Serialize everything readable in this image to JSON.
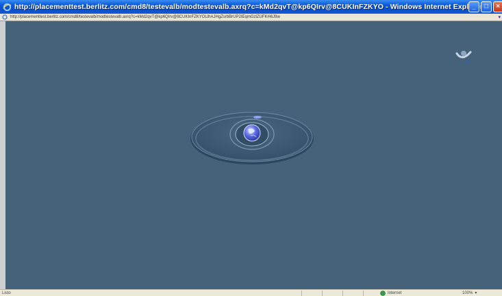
{
  "window": {
    "title": "http://placementtest.berlitz.com/cmd8/testevalb/modtestevalb.axrq?c=kMd2qvT@kp6QIrv@8CUKInFZKYO - Windows Internet Explorer",
    "buttons": {
      "minimize": "_",
      "maximize": "□",
      "close": "×"
    }
  },
  "address": {
    "url": "http://placementtest.berlitz.com/cmd8/testevalb/modtestevalb.axrq?c=kMd2qvT@kp6QIrv@8CUKInFZKYOLlhAJHgZsrbBrUP2IEqmGzlZUFKH6J9w"
  },
  "status": {
    "text": "Listo",
    "zone": "Internet",
    "zoom": "100%"
  },
  "colors": {
    "background": "#45627a",
    "titlebar": "#0c5bd8",
    "disc": "#3e5b72"
  }
}
